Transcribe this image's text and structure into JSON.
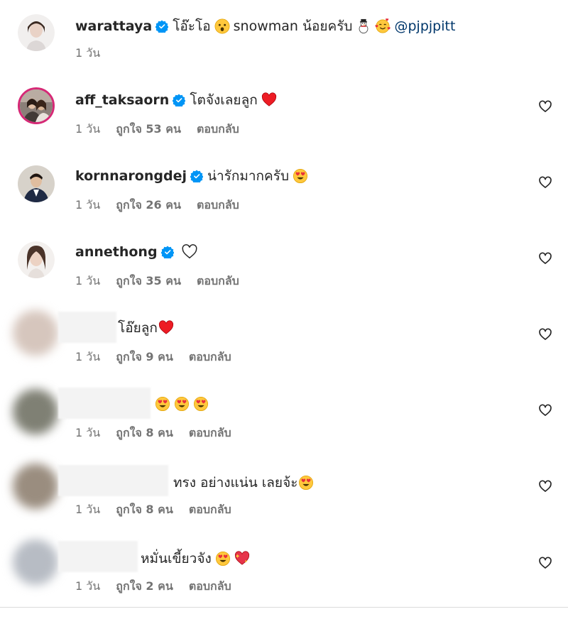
{
  "colors": {
    "text": "#262626",
    "secondary": "#737373",
    "verified": "#0095f6",
    "mention": "#00376b",
    "heart_red": "#ed1c24"
  },
  "comments": [
    {
      "username": "warattaya",
      "verified": true,
      "text": "โอ๊ะโอ",
      "text2": "snowman น้อยครับ",
      "mention": "@pjpjpitt",
      "time": "1 วัน"
    },
    {
      "username": "aff_taksaorn",
      "verified": true,
      "text": "โตจังเลยลูก",
      "time": "1 วัน",
      "likes": "ถูกใจ 53 คน",
      "reply": "ตอบกลับ"
    },
    {
      "username": "kornnarongdej",
      "verified": true,
      "text": "น่ารักมากครับ",
      "time": "1 วัน",
      "likes": "ถูกใจ 26 คน",
      "reply": "ตอบกลับ"
    },
    {
      "username": "annethong",
      "verified": true,
      "text": "",
      "time": "1 วัน",
      "likes": "ถูกใจ 35 คน",
      "reply": "ตอบกลับ"
    },
    {
      "username": "",
      "text": "โอ๊ยลูก",
      "time": "1 วัน",
      "likes": "ถูกใจ 9 คน",
      "reply": "ตอบกลับ"
    },
    {
      "username": "",
      "text": "",
      "time": "1 วัน",
      "likes": "ถูกใจ 8 คน",
      "reply": "ตอบกลับ"
    },
    {
      "username": "",
      "text": "ทรง อย่างแน่น เลยจ้ะ",
      "time": "1 วัน",
      "likes": "ถูกใจ 8 คน",
      "reply": "ตอบกลับ"
    },
    {
      "username": "",
      "text": "หมั่นเขี้ยวจัง",
      "time": "1 วัน",
      "likes": "ถูกใจ 2 คน",
      "reply": "ตอบกลับ"
    }
  ]
}
